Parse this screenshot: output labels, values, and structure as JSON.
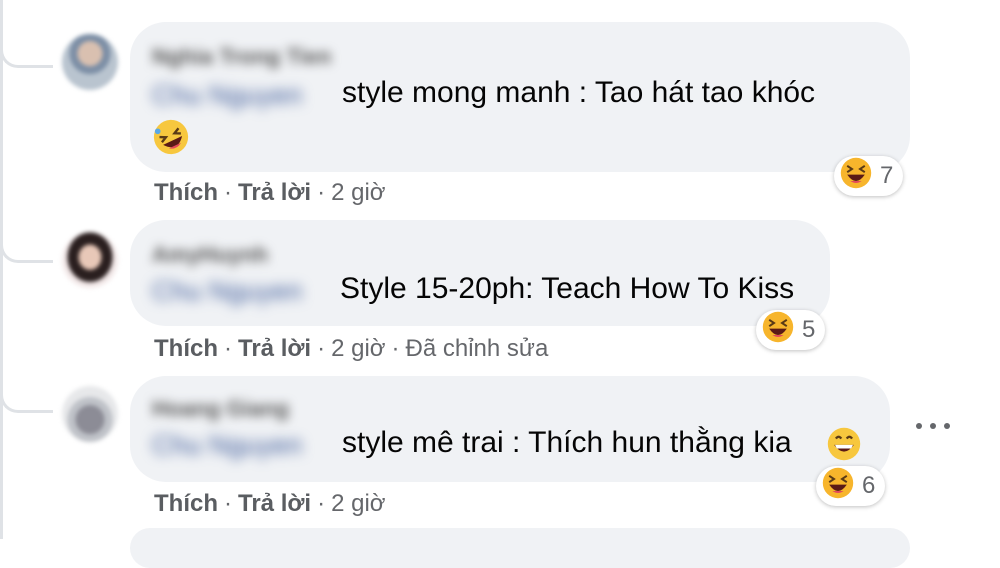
{
  "comments": [
    {
      "author": "Nghia Trong Tien",
      "mention": "Chu Nguyen",
      "text": "style mong manh : Tao hát tao khóc",
      "reaction_count": "7",
      "actions": {
        "like": "Thích",
        "reply": "Trả lời",
        "time": "2 giờ",
        "edited": ""
      }
    },
    {
      "author": "AmyHuynh",
      "mention": "Chu Nguyen",
      "text": "Style 15-20ph: Teach How To Kiss",
      "reaction_count": "5",
      "actions": {
        "like": "Thích",
        "reply": "Trả lời",
        "time": "2 giờ",
        "edited": "Đã chỉnh sửa"
      }
    },
    {
      "author": "Hoang Giang",
      "mention": "Chu Nguyen",
      "text": "style mê trai : Thích hun thằng kia",
      "reaction_count": "6",
      "actions": {
        "like": "Thích",
        "reply": "Trả lời",
        "time": "2 giờ",
        "edited": ""
      }
    }
  ],
  "separator": "·",
  "icons": {
    "reaction": "laughing-emoji-icon",
    "inline_1": "rolling-laughing-emoji-icon",
    "inline_3": "grinning-emoji-icon",
    "more": "more-options-icon"
  },
  "colors": {
    "bubble": "#f0f2f5",
    "meta": "#65676b",
    "text": "#050505"
  }
}
